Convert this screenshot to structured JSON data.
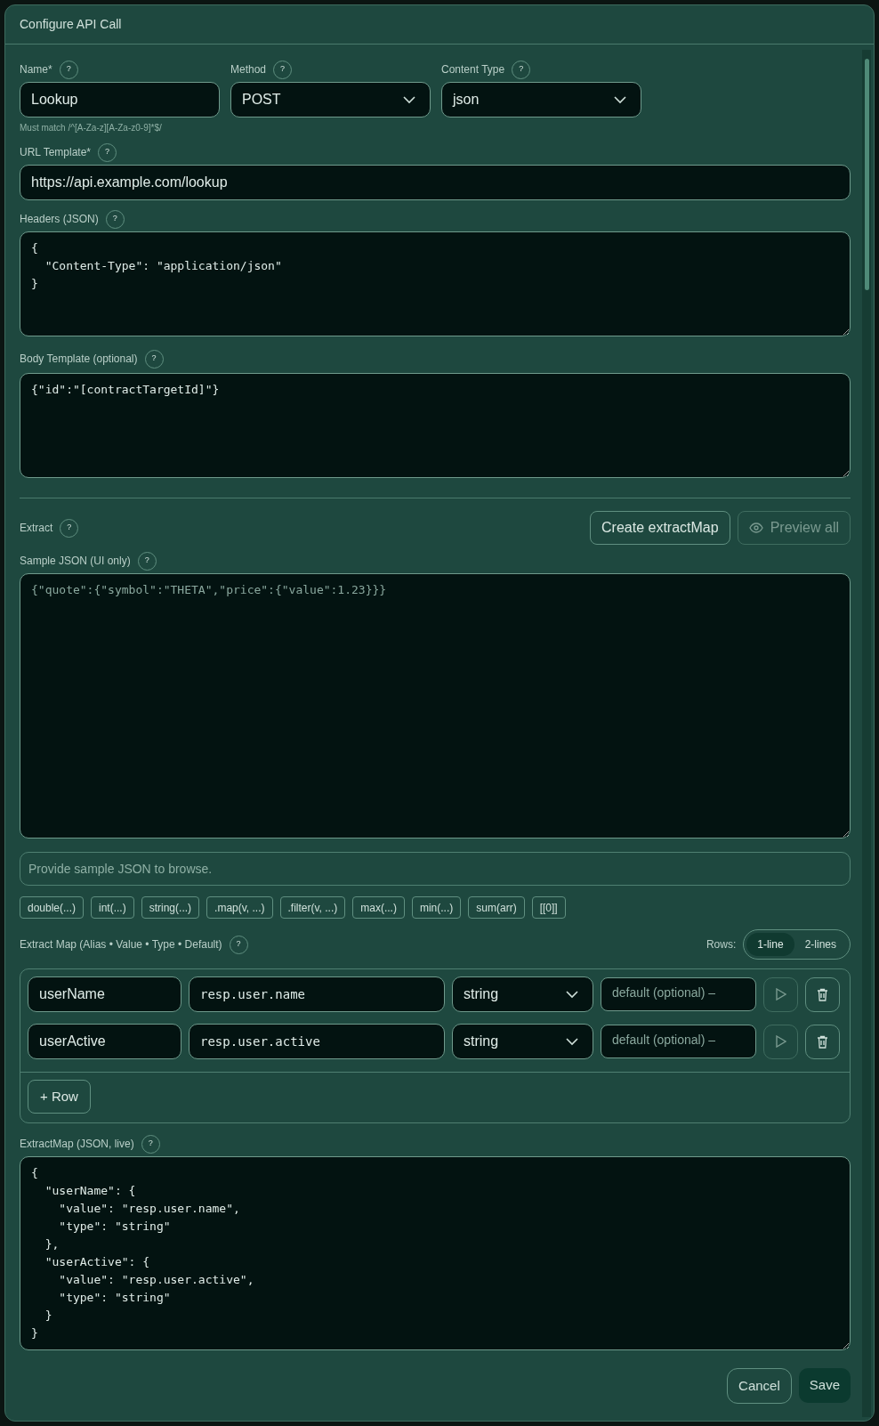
{
  "dialog": {
    "title": "Configure API Call"
  },
  "name_field": {
    "label": "Name*",
    "help": "?",
    "value": "Lookup",
    "hint": "Must match /^[A-Za-z][A-Za-z0-9]*$/"
  },
  "method_field": {
    "label": "Method",
    "help": "?",
    "value": "POST"
  },
  "content_type_field": {
    "label": "Content Type",
    "help": "?",
    "value": "json"
  },
  "url_field": {
    "label": "URL Template*",
    "help": "?",
    "value": "https://api.example.com/lookup"
  },
  "headers_field": {
    "label": "Headers (JSON)",
    "help": "?",
    "value": "{\n  \"Content-Type\": \"application/json\"\n}"
  },
  "body_field": {
    "label": "Body Template (optional)",
    "help": "?",
    "value": "{\"id\":\"[contractTargetId]\"}"
  },
  "extract": {
    "label": "Extract",
    "help": "?",
    "create_button": "Create extractMap",
    "preview_button": {
      "label": "Preview all",
      "disabled": true
    }
  },
  "sample_json": {
    "label": "Sample JSON (UI only)",
    "help": "?",
    "placeholder": "{\"quote\":{\"symbol\":\"THETA\",\"price\":{\"value\":1.23}}}"
  },
  "browse_placeholder": "Provide sample JSON to browse.",
  "chips": [
    "double(...)",
    "int(...)",
    "string(...)",
    ".map(v, ...)",
    ".filter(v, ...)",
    "max(...)",
    "min(...)",
    "sum(arr)",
    "[[0]]"
  ],
  "extract_map": {
    "label": "Extract Map (Alias • Value • Type • Default)",
    "help": "?",
    "rows_label": "Rows:",
    "row_modes": [
      {
        "label": "1-line",
        "selected": true
      },
      {
        "label": "2-lines",
        "selected": false
      }
    ],
    "rows": [
      {
        "alias": "userName",
        "value": "resp.user.name",
        "type": "string",
        "default_placeholder": "default (optional) –"
      },
      {
        "alias": "userActive",
        "value": "resp.user.active",
        "type": "string",
        "default_placeholder": "default (optional) –"
      }
    ],
    "add_button": "+ Row"
  },
  "extract_map_json": {
    "label": "ExtractMap (JSON, live)",
    "help": "?",
    "value": "{\n  \"userName\": {\n    \"value\": \"resp.user.name\",\n    \"type\": \"string\"\n  },\n  \"userActive\": {\n    \"value\": \"resp.user.active\",\n    \"type\": \"string\"\n  }\n}"
  },
  "buttons": {
    "cancel": "Cancel",
    "save": "Save"
  }
}
